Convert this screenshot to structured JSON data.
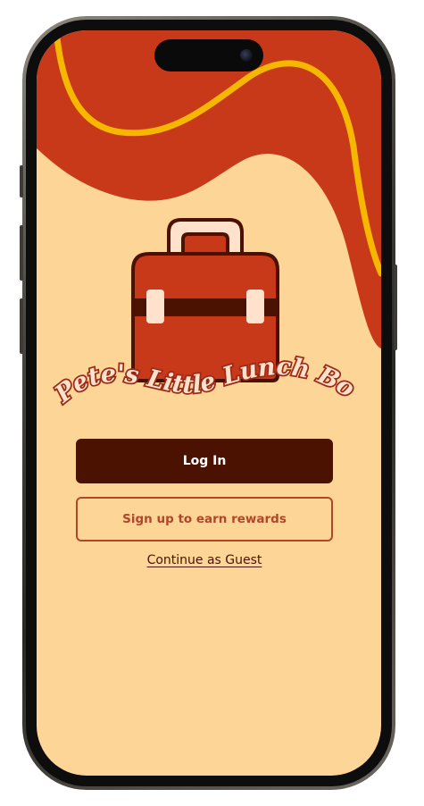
{
  "app": {
    "brand_name": "Pete's Little Lunch Box",
    "logo_icon": "lunchbox-icon"
  },
  "actions": {
    "login_label": "Log In",
    "signup_label": "Sign up to earn rewards",
    "guest_label": "Continue as Guest"
  },
  "colors": {
    "background": "#fdd597",
    "wave_red": "#c8391a",
    "wave_stripe": "#f5b700",
    "primary_button": "#4b1202",
    "outline_button": "#b0462a",
    "text_dark": "#4b1202"
  }
}
